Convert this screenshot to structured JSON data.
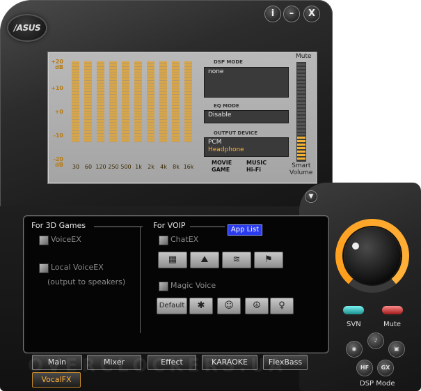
{
  "window": {
    "logo_text": "/ASUS",
    "title_buttons": [
      {
        "name": "info",
        "glyph": "i"
      },
      {
        "name": "minimize",
        "glyph": "–"
      },
      {
        "name": "close",
        "glyph": "X"
      }
    ]
  },
  "display": {
    "db_labels": [
      "+20\ndB",
      "+10",
      "+0",
      "-10",
      "-20\ndB"
    ],
    "eq_frequencies": [
      "30",
      "60",
      "120",
      "250",
      "500",
      "1k",
      "2k",
      "4k",
      "8k",
      "16k"
    ],
    "dsp_mode": {
      "label": "DSP MODE",
      "value": "none"
    },
    "eq_mode": {
      "label": "EQ MODE",
      "value": "Disable"
    },
    "output_device": {
      "label": "OUTPUT DEVICE",
      "line1": "PCM",
      "line2": "Headphone",
      "line2_color": "#ffb13c"
    },
    "mode_buttons": [
      {
        "left": "MOVIE",
        "right": "MUSIC"
      },
      {
        "left": "GAME",
        "right": "Hi-Fi"
      }
    ],
    "mute_label": "Mute",
    "smart_volume_label": "Smart\nVolume",
    "volume_level": 0.24
  },
  "vocalfx": {
    "games_header": "For 3D Games",
    "voiceex_label": "VoiceEX",
    "local_voiceex_label": "Local VoiceEX",
    "local_voiceex_note": "(output to speakers)",
    "voip_header": "For VOIP",
    "app_list_button": "App List",
    "chatex_label": "ChatEX",
    "chatex_icons": [
      "office-icon",
      "concert-hall-icon",
      "street-icon",
      "stadium-icon"
    ],
    "magic_voice_label": "Magic Voice",
    "magic_voice_default": "Default",
    "magic_voice_icons": [
      "monster-icon",
      "cartoon-icon",
      "male-icon",
      "female-icon"
    ]
  },
  "tabs": {
    "row1": [
      "Main",
      "Mixer",
      "Effect",
      "KARAOKE",
      "FlexBass"
    ],
    "row2": [
      "VocalFX"
    ],
    "active": "VocalFX"
  },
  "right_panel": {
    "svn_label": "SVN",
    "mute_label": "Mute",
    "svn_color": "#38d4d2",
    "mute_color": "#e23b3b",
    "knob_accent": "#ff9d1a",
    "dsp_mode_label": "DSP Mode",
    "dsp_buttons": [
      "game-icon",
      "music-icon",
      "movie-icon",
      "HF",
      "GX"
    ]
  },
  "watermark": "OVERCLOCKERS.UA"
}
